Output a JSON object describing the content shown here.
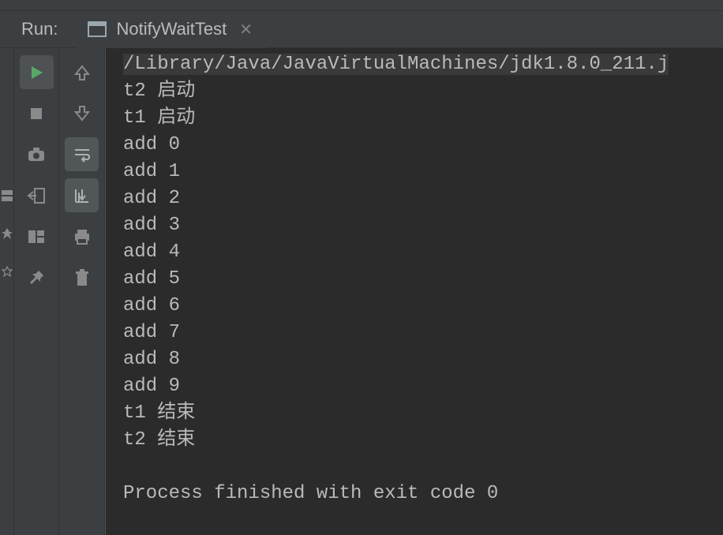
{
  "header": {
    "run_label": "Run:",
    "tab_label": "NotifyWaitTest"
  },
  "console": {
    "command_line": "/Library/Java/JavaVirtualMachines/jdk1.8.0_211.j",
    "output_lines": [
      "t2 启动",
      "t1 启动",
      "add 0",
      "add 1",
      "add 2",
      "add 3",
      "add 4",
      "add 5",
      "add 6",
      "add 7",
      "add 8",
      "add 9",
      "t1 结束",
      "t2 结束",
      "",
      "Process finished with exit code 0"
    ]
  }
}
